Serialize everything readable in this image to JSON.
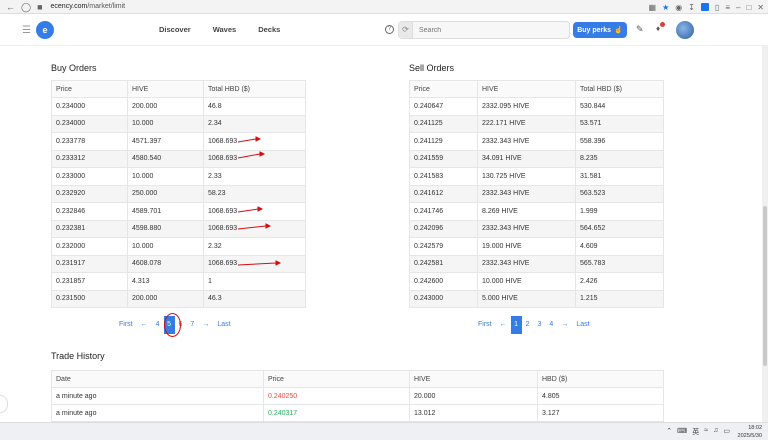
{
  "browser": {
    "url_domain": "ecency.com",
    "url_path": "/market/limit"
  },
  "header": {
    "logo_letter": "e",
    "nav": [
      "Discover",
      "Waves",
      "Decks"
    ],
    "search_placeholder": "Search",
    "buy_perks_label": "Buy perks"
  },
  "buy_orders": {
    "title": "Buy Orders",
    "columns": [
      "Price",
      "HIVE",
      "Total HBD ($)"
    ],
    "rows": [
      [
        "0.234000",
        "200.000",
        "46.8"
      ],
      [
        "0.234000",
        "10.000",
        "2.34"
      ],
      [
        "0.233778",
        "4571.397",
        "1068.693"
      ],
      [
        "0.233312",
        "4580.540",
        "1068.693"
      ],
      [
        "0.233000",
        "10.000",
        "2.33"
      ],
      [
        "0.232920",
        "250.000",
        "58.23"
      ],
      [
        "0.232846",
        "4589.701",
        "1068.693"
      ],
      [
        "0.232381",
        "4598.880",
        "1068.693"
      ],
      [
        "0.232000",
        "10.000",
        "2.32"
      ],
      [
        "0.231917",
        "4608.078",
        "1068.693"
      ],
      [
        "0.231857",
        "4.313",
        "1"
      ],
      [
        "0.231500",
        "200.000",
        "46.3"
      ]
    ],
    "pagination": {
      "first": "First",
      "prev": "←",
      "pages": [
        "4",
        "5",
        "6",
        "7"
      ],
      "active": "5",
      "next": "→",
      "last": "Last"
    }
  },
  "sell_orders": {
    "title": "Sell Orders",
    "columns": [
      "Price",
      "HIVE",
      "Total HBD ($)"
    ],
    "rows": [
      [
        "0.240647",
        "2332.095 HIVE",
        "530.844"
      ],
      [
        "0.241125",
        "222.171 HIVE",
        "53.571"
      ],
      [
        "0.241129",
        "2332.343 HIVE",
        "558.396"
      ],
      [
        "0.241559",
        "34.091 HIVE",
        "8.235"
      ],
      [
        "0.241583",
        "130.725 HIVE",
        "31.581"
      ],
      [
        "0.241612",
        "2332.343 HIVE",
        "563.523"
      ],
      [
        "0.241746",
        "8.269 HIVE",
        "1.999"
      ],
      [
        "0.242096",
        "2332.343 HIVE",
        "564.652"
      ],
      [
        "0.242579",
        "19.000 HIVE",
        "4.609"
      ],
      [
        "0.242581",
        "2332.343 HIVE",
        "565.783"
      ],
      [
        "0.242600",
        "10.000 HIVE",
        "2.426"
      ],
      [
        "0.243000",
        "5.000 HIVE",
        "1.215"
      ]
    ],
    "pagination": {
      "first": "First",
      "prev": "←",
      "pages": [
        "1",
        "2",
        "3",
        "4"
      ],
      "active": "1",
      "next": "→",
      "last": "Last"
    }
  },
  "trade_history": {
    "title": "Trade History",
    "columns": [
      "Date",
      "Price",
      "HIVE",
      "HBD ($)"
    ],
    "rows": [
      {
        "date": "a minute ago",
        "price": "0.240250",
        "direction": "sell",
        "hive": "20.000",
        "hbd": "4.805"
      },
      {
        "date": "a minute ago",
        "price": "0.240317",
        "direction": "buy",
        "hive": "13.012",
        "hbd": "3.127"
      }
    ]
  },
  "taskbar": {
    "time": "18:02",
    "date": "2025/5/30",
    "ime": "英"
  },
  "colors": {
    "accent": "#357ce6",
    "sell_price": "#e74c3c",
    "buy_price": "#27ae60",
    "annotation": "#d01010"
  }
}
